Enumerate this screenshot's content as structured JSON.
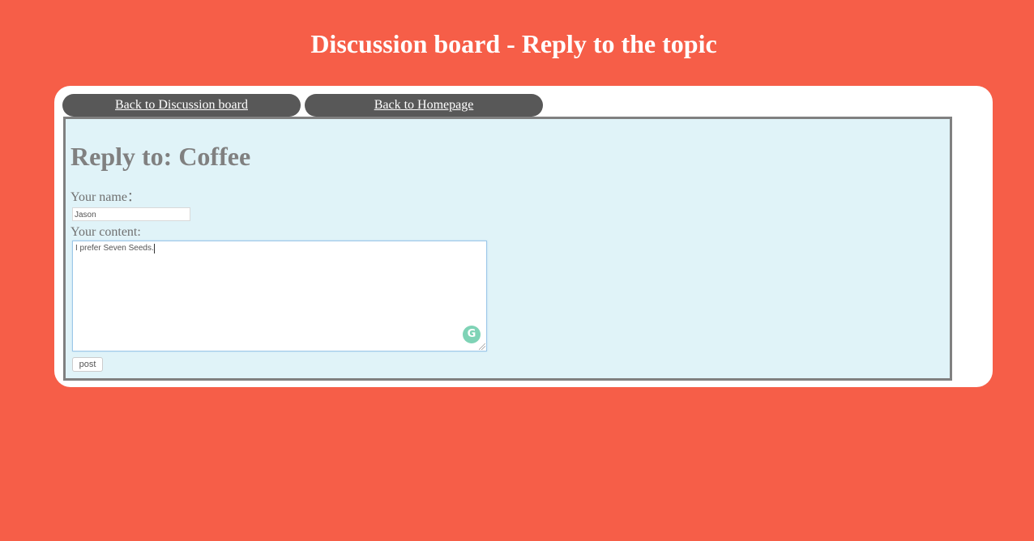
{
  "header": {
    "title": "Discussion board - Reply to the topic"
  },
  "nav": {
    "back_discussion": "Back to Discussion board",
    "back_home": "Back to Homepage"
  },
  "form": {
    "heading": "Reply to: Coffee",
    "name_label": "Your name：",
    "name_value": "Jason",
    "content_label": "Your content:",
    "content_value": "I prefer Seven Seeds.",
    "submit_label": "post"
  },
  "icons": {
    "grammar_icon": "grammarly-g-icon",
    "resize_icon": "resize-handle-icon"
  },
  "colors": {
    "background": "#f65e48",
    "card": "#ffffff",
    "nav_button": "#585858",
    "panel": "#e0f3f8",
    "panel_border": "#808080",
    "grammar_icon": "#7fd3b6"
  }
}
